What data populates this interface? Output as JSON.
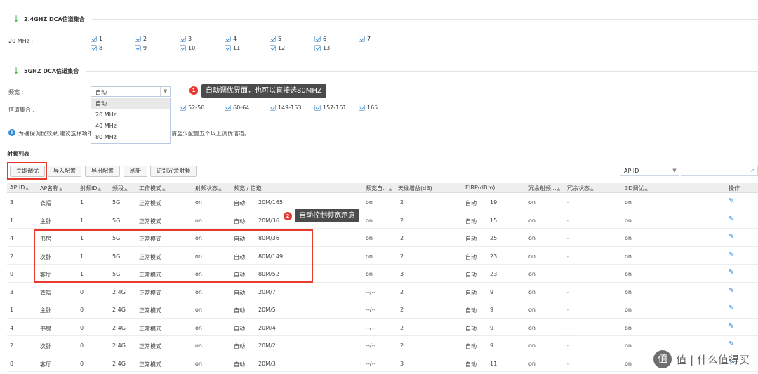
{
  "section_24": {
    "title": "2.4GHZ DCA信道集合"
  },
  "bw20": {
    "label": "20 MHz :",
    "channels": [
      "1",
      "2",
      "3",
      "4",
      "5",
      "6",
      "7",
      "8",
      "9",
      "10",
      "11",
      "12",
      "13"
    ]
  },
  "section_5g": {
    "title": "5GHZ DCA信道集合"
  },
  "bandwidth": {
    "label": "频宽 :",
    "selected": "自动",
    "options": [
      "自动",
      "20 MHz",
      "40 MHz",
      "80 MHz"
    ]
  },
  "callout1": {
    "num": "1",
    "text": "自动调优界面，也可以直接选80MHZ"
  },
  "channel_set": {
    "label": "信道集合 :",
    "groups": [
      "52-56",
      "60-64",
      "149-153",
      "157-161",
      "165"
    ]
  },
  "notice": {
    "left": "为确保调优效果,建议选择项不",
    "right": "请至少配置五个以上调优信道。"
  },
  "radio_list": {
    "title": "射频列表"
  },
  "toolbar": {
    "tune_now": "立即调优",
    "import": "导入配置",
    "export": "导出配置",
    "refresh": "刷新",
    "identify": "识别冗余射频"
  },
  "search": {
    "field": "AP ID",
    "value": ""
  },
  "callout2": {
    "num": "2",
    "text": "自动控制频宽示意"
  },
  "table": {
    "headers": [
      "AP ID",
      "AP名称",
      "射频ID",
      "频段",
      "工作模式",
      "射频状态",
      "频宽 / 信道",
      "频宽自...",
      "天线增益(dB)",
      "EIRP(dBm)",
      "冗余射频...",
      "冗余状态",
      "3D调优",
      "操作"
    ],
    "rows": [
      [
        "3",
        "衣帽",
        "1",
        "5G",
        "正常模式",
        "on",
        "自动",
        "20M/165",
        "on",
        "2",
        "自动",
        "19",
        "on",
        "-",
        "on"
      ],
      [
        "1",
        "主卧",
        "1",
        "5G",
        "正常模式",
        "on",
        "自动",
        "20M/36",
        "on",
        "2",
        "自动",
        "15",
        "on",
        "-",
        "on"
      ],
      [
        "4",
        "书房",
        "1",
        "5G",
        "正常模式",
        "on",
        "自动",
        "80M/36",
        "on",
        "2",
        "自动",
        "25",
        "on",
        "-",
        "on"
      ],
      [
        "2",
        "次卧",
        "1",
        "5G",
        "正常模式",
        "on",
        "自动",
        "80M/149",
        "on",
        "2",
        "自动",
        "23",
        "on",
        "-",
        "on"
      ],
      [
        "0",
        "客厅",
        "1",
        "5G",
        "正常模式",
        "on",
        "自动",
        "80M/52",
        "on",
        "3",
        "自动",
        "23",
        "on",
        "-",
        "on"
      ],
      [
        "3",
        "衣帽",
        "0",
        "2.4G",
        "正常模式",
        "on",
        "自动",
        "20M/7",
        "--/--",
        "2",
        "自动",
        "9",
        "on",
        "-",
        "on"
      ],
      [
        "1",
        "主卧",
        "0",
        "2.4G",
        "正常模式",
        "on",
        "自动",
        "20M/5",
        "--/--",
        "2",
        "自动",
        "9",
        "on",
        "-",
        "on"
      ],
      [
        "4",
        "书房",
        "0",
        "2.4G",
        "正常模式",
        "on",
        "自动",
        "20M/4",
        "--/--",
        "2",
        "自动",
        "9",
        "on",
        "-",
        "on"
      ],
      [
        "2",
        "次卧",
        "0",
        "2.4G",
        "正常模式",
        "on",
        "自动",
        "20M/2",
        "--/--",
        "2",
        "自动",
        "9",
        "on",
        "-",
        "on"
      ],
      [
        "0",
        "客厅",
        "0",
        "2.4G",
        "正常模式",
        "on",
        "自动",
        "20M/3",
        "--/--",
        "3",
        "自动",
        "11",
        "on",
        "-",
        "on"
      ]
    ]
  },
  "watermark": {
    "text": "值 | 什么值得买"
  },
  "icons": {
    "section": "arrow-down-icon",
    "info": "info-icon",
    "edit": "pencil-icon",
    "search": "search-icon"
  },
  "colors": {
    "accent": "#2f8ad8",
    "callout_red": "#e8392f",
    "section_arrow": "#3bb54a"
  }
}
